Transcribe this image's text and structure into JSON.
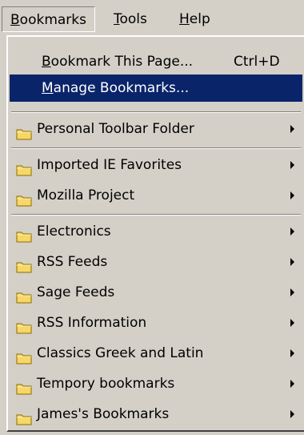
{
  "menubar": {
    "items": [
      {
        "prefix": "",
        "ul": "B",
        "rest": "ookmarks"
      },
      {
        "prefix": "",
        "ul": "T",
        "rest": "ools"
      },
      {
        "prefix": "",
        "ul": "H",
        "rest": "elp"
      }
    ]
  },
  "menu": {
    "bookmark_this_page": {
      "prefix": "",
      "ul": "B",
      "rest": "ookmark This Page...",
      "shortcut": "Ctrl+D"
    },
    "manage_bookmarks": {
      "prefix": "",
      "ul": "M",
      "rest": "anage Bookmarks..."
    },
    "folders": [
      {
        "label": "Personal Toolbar Folder"
      },
      {
        "label": "Imported IE Favorites"
      },
      {
        "label": "Mozilla Project"
      },
      {
        "label": "Electronics"
      },
      {
        "label": "RSS Feeds"
      },
      {
        "label": "Sage Feeds"
      },
      {
        "label": "RSS Information"
      },
      {
        "label": "Classics Greek and Latin"
      },
      {
        "label": "Tempory bookmarks"
      },
      {
        "label": "James's Bookmarks"
      }
    ],
    "highlight_color": "#0a246a",
    "folder_icon": "folder-icon",
    "submenu_icon": "chevron-right-icon"
  }
}
